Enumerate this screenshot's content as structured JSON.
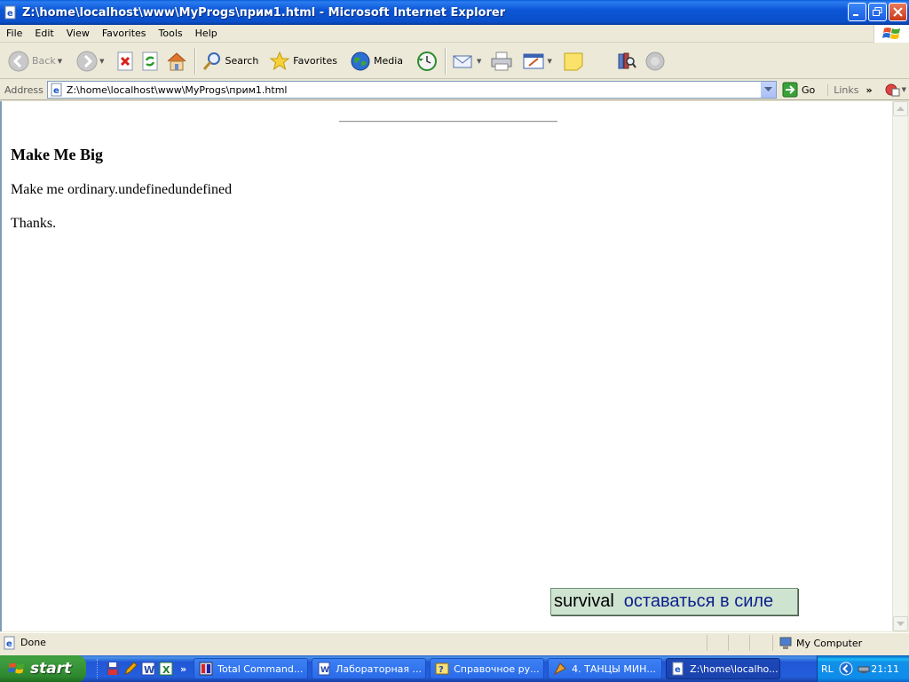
{
  "window": {
    "title": "Z:\\home\\localhost\\www\\MyProgs\\прим1.html - Microsoft Internet Explorer"
  },
  "menu": [
    "File",
    "Edit",
    "View",
    "Favorites",
    "Tools",
    "Help"
  ],
  "toolbar": {
    "back": "Back",
    "search": "Search",
    "favorites": "Favorites",
    "media": "Media"
  },
  "address": {
    "label": "Address",
    "value": "Z:\\home\\localhost\\www\\MyProgs\\прим1.html",
    "go": "Go",
    "links": "Links"
  },
  "page": {
    "heading": "Make Me Big",
    "paragraph1": "Make me ordinary.undefinedundefined",
    "paragraph2": "Thanks.",
    "tooltip_en": "survival",
    "tooltip_ru": "оставаться в силе"
  },
  "status": {
    "text": "Done",
    "zone": "My Computer"
  },
  "taskbar": {
    "start": "start",
    "tasks": [
      {
        "label": "Total Command...",
        "icon": "total-commander-icon"
      },
      {
        "label": "Лабораторная ...",
        "icon": "word-document-icon"
      },
      {
        "label": "Справочное ру...",
        "icon": "help-file-icon"
      },
      {
        "label": "4. ТАНЦЫ МИН...",
        "icon": "media-player-icon"
      },
      {
        "label": "Z:\\home\\localho...",
        "icon": "ie-icon"
      }
    ],
    "language": "RL",
    "clock": "21:11"
  }
}
